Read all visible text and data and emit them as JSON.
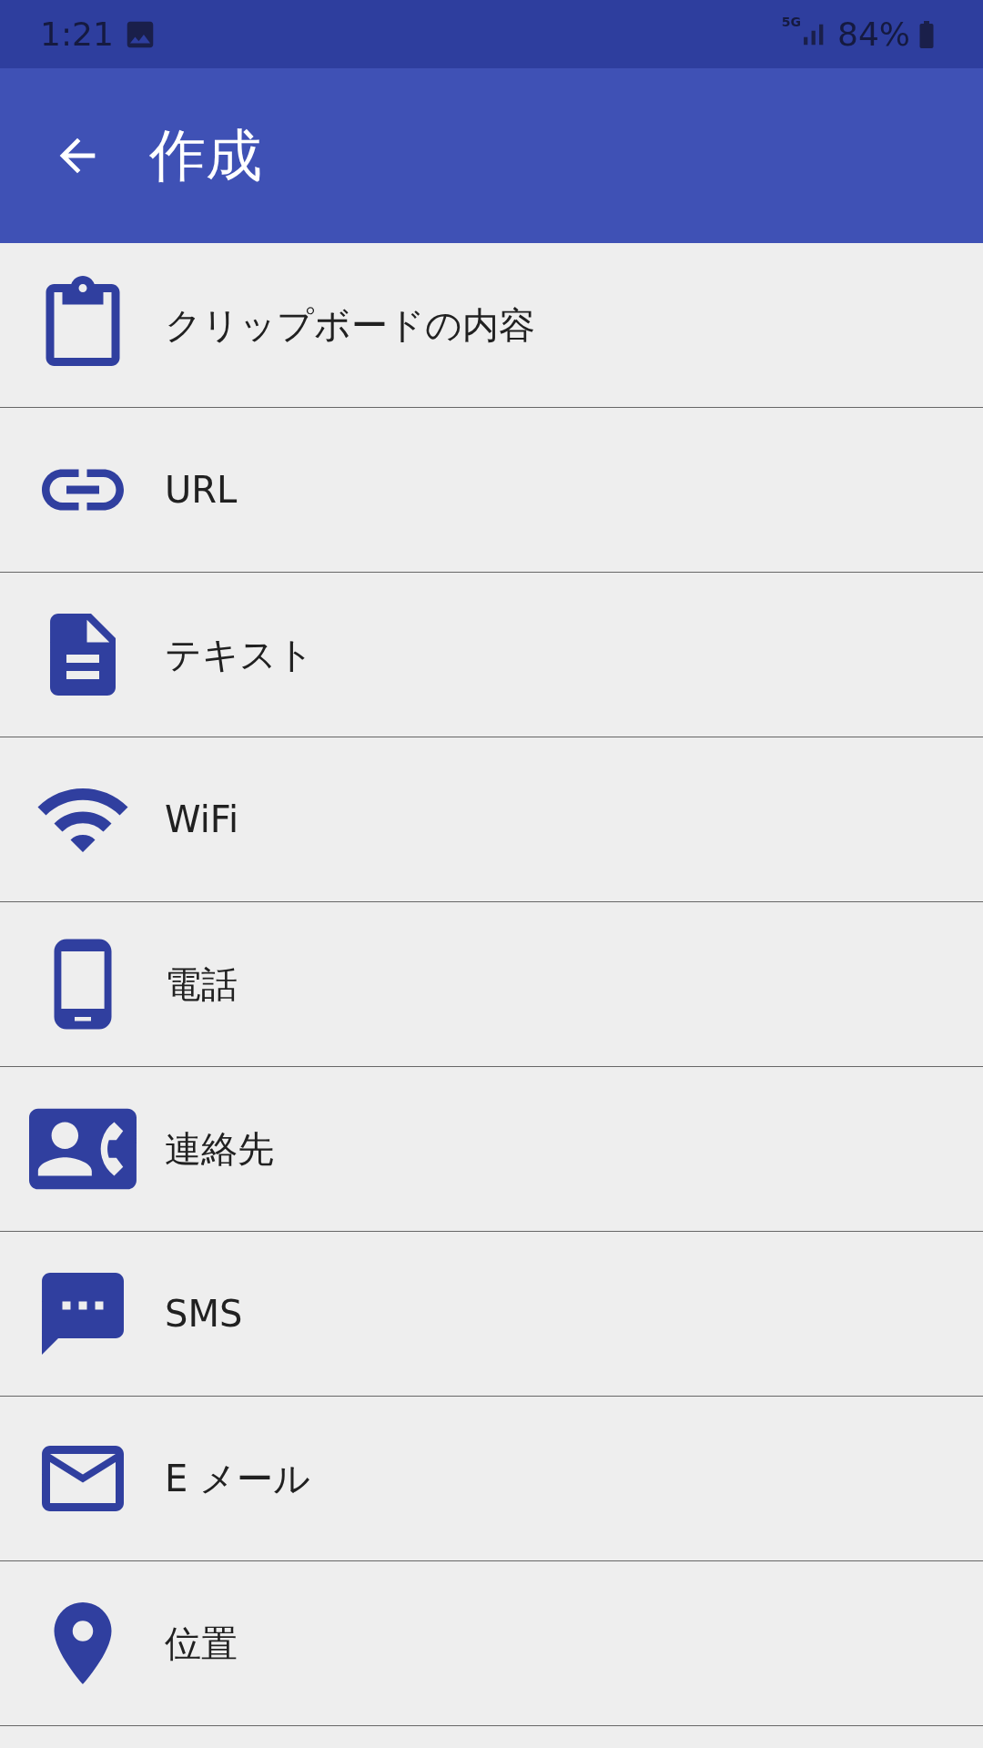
{
  "status_bar": {
    "time": "1:21",
    "network": "5G",
    "battery": "84%"
  },
  "app_bar": {
    "title": "作成"
  },
  "items": [
    {
      "kind": "clipboard",
      "label": "クリップボードの内容"
    },
    {
      "kind": "link",
      "label": "URL"
    },
    {
      "kind": "text",
      "label": "テキスト"
    },
    {
      "kind": "wifi",
      "label": "WiFi"
    },
    {
      "kind": "phone",
      "label": "電話"
    },
    {
      "kind": "contact",
      "label": "連絡先"
    },
    {
      "kind": "sms",
      "label": "SMS"
    },
    {
      "kind": "email",
      "label": "E メール"
    },
    {
      "kind": "location",
      "label": "位置"
    }
  ]
}
